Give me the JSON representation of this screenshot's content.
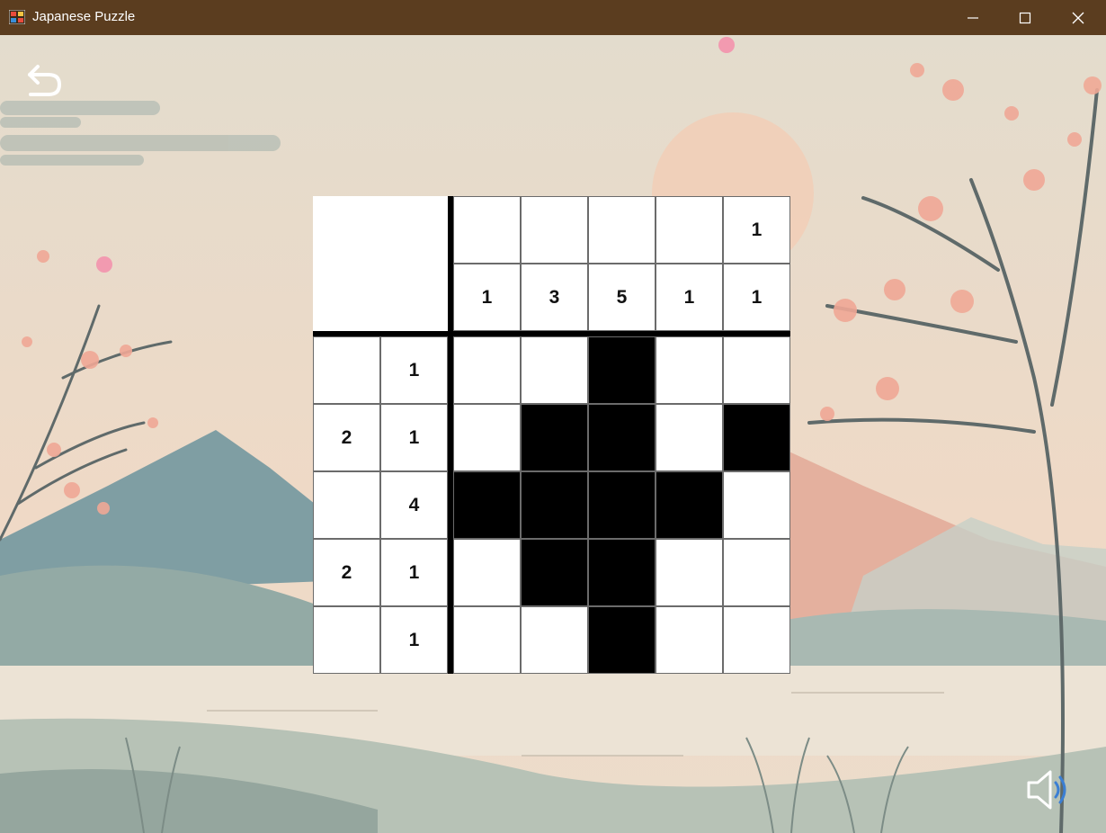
{
  "window": {
    "title": "Japanese Puzzle",
    "titlebar_color": "#5b3d1f",
    "icons": [
      "app-icon",
      "minimize-icon",
      "maximize-icon",
      "close-icon"
    ]
  },
  "controls": {
    "back_icon": "undo-arrow-icon",
    "sound_icon": "speaker-volume-icon"
  },
  "puzzle": {
    "size": 5,
    "column_clues": [
      [
        "",
        "1"
      ],
      [
        "",
        "3"
      ],
      [
        "",
        "5"
      ],
      [
        "",
        "1"
      ],
      [
        "1",
        "1"
      ]
    ],
    "row_clues": [
      [
        "",
        "1"
      ],
      [
        "2",
        "1"
      ],
      [
        "",
        "4"
      ],
      [
        "2",
        "1"
      ],
      [
        "",
        "1"
      ]
    ],
    "grid": [
      [
        0,
        0,
        1,
        0,
        0
      ],
      [
        0,
        1,
        1,
        0,
        1
      ],
      [
        1,
        1,
        1,
        1,
        0
      ],
      [
        0,
        1,
        1,
        0,
        0
      ],
      [
        0,
        0,
        1,
        0,
        0
      ]
    ],
    "filled_color": "#000000",
    "empty_color": "#ffffff"
  }
}
